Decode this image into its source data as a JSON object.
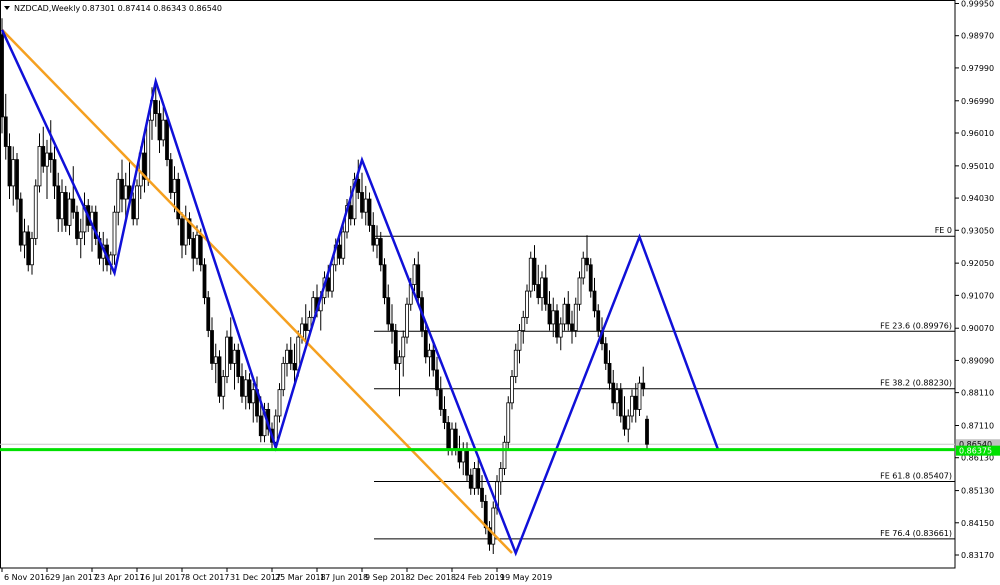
{
  "chart_data": {
    "type": "candlestick",
    "title": "NZDCAD,Weekly",
    "ohlc_header": [
      "0.87301",
      "0.87414",
      "0.86343",
      "0.86540"
    ],
    "ylim": [
      0.8317,
      0.9995
    ],
    "y_ticks": [
      "0.99950",
      "0.98970",
      "0.97990",
      "0.96990",
      "0.96010",
      "0.95010",
      "0.94030",
      "0.93050",
      "0.92050",
      "0.91070",
      "0.90070",
      "0.89090",
      "0.88110",
      "0.87110",
      "0.86130",
      "0.85130",
      "0.84150",
      "0.83170"
    ],
    "x_ticks": [
      "6 Nov 2016",
      "29 Jan 2017",
      "23 Apr 2017",
      "16 Jul 2017",
      "8 Oct 2017",
      "31 Dec 2017",
      "25 Mar 2018",
      "17 Jun 2018",
      "9 Sep 2018",
      "2 Dec 2018",
      "24 Feb 2019",
      "19 May 2019"
    ],
    "price_label_current": "0.86540",
    "price_label_level": "0.86375",
    "current_price": 0.8654,
    "support_level": 0.86375,
    "fib_levels": [
      {
        "label": "FE 0",
        "value": 0.9287
      },
      {
        "label": "FE 23.6 (0.89976)",
        "value": 0.89976
      },
      {
        "label": "FE 38.2 (0.88230)",
        "value": 0.8823
      },
      {
        "label": "FE 61.8 (0.85407)",
        "value": 0.85407
      },
      {
        "label": "FE 76.4 (0.83661)",
        "value": 0.83661
      }
    ],
    "zigzag": [
      {
        "week": 0,
        "price": 0.9915
      },
      {
        "week": 30,
        "price": 0.9175
      },
      {
        "week": 41,
        "price": 0.9758
      },
      {
        "week": 73,
        "price": 0.8644
      },
      {
        "week": 96,
        "price": 0.9519
      },
      {
        "week": 137,
        "price": 0.8323
      },
      {
        "week": 170,
        "price": 0.9285
      },
      {
        "week": 191,
        "price": 0.8636
      }
    ],
    "trendline": [
      {
        "week": 0,
        "price": 0.9915
      },
      {
        "week": 136,
        "price": 0.8323
      }
    ],
    "colors": {
      "zigzag": "#1010d8",
      "trendline": "#f5a020",
      "support": "#00e000",
      "fib": "#000000",
      "bull": "#ffffff",
      "bear": "#000000"
    },
    "candles": [
      [
        0.99,
        0.995,
        0.96,
        0.965
      ],
      [
        0.965,
        0.972,
        0.952,
        0.956
      ],
      [
        0.956,
        0.96,
        0.94,
        0.944
      ],
      [
        0.944,
        0.956,
        0.938,
        0.952
      ],
      [
        0.952,
        0.954,
        0.936,
        0.94
      ],
      [
        0.94,
        0.942,
        0.924,
        0.926
      ],
      [
        0.926,
        0.934,
        0.922,
        0.93
      ],
      [
        0.93,
        0.932,
        0.918,
        0.92
      ],
      [
        0.92,
        0.93,
        0.917,
        0.928
      ],
      [
        0.928,
        0.946,
        0.926,
        0.944
      ],
      [
        0.944,
        0.96,
        0.942,
        0.956
      ],
      [
        0.956,
        0.962,
        0.948,
        0.95
      ],
      [
        0.95,
        0.958,
        0.94,
        0.954
      ],
      [
        0.954,
        0.964,
        0.948,
        0.952
      ],
      [
        0.952,
        0.956,
        0.94,
        0.944
      ],
      [
        0.944,
        0.948,
        0.93,
        0.934
      ],
      [
        0.934,
        0.946,
        0.93,
        0.942
      ],
      [
        0.942,
        0.944,
        0.93,
        0.932
      ],
      [
        0.932,
        0.942,
        0.929,
        0.94
      ],
      [
        0.94,
        0.95,
        0.934,
        0.936
      ],
      [
        0.936,
        0.938,
        0.926,
        0.928
      ],
      [
        0.928,
        0.934,
        0.922,
        0.93
      ],
      [
        0.93,
        0.942,
        0.926,
        0.938
      ],
      [
        0.938,
        0.94,
        0.93,
        0.932
      ],
      [
        0.932,
        0.938,
        0.924,
        0.936
      ],
      [
        0.936,
        0.938,
        0.926,
        0.928
      ],
      [
        0.928,
        0.93,
        0.92,
        0.922
      ],
      [
        0.922,
        0.93,
        0.918,
        0.926
      ],
      [
        0.926,
        0.928,
        0.918,
        0.92
      ],
      [
        0.92,
        0.924,
        0.917,
        0.923
      ],
      [
        0.923,
        0.938,
        0.92,
        0.936
      ],
      [
        0.936,
        0.948,
        0.932,
        0.946
      ],
      [
        0.946,
        0.952,
        0.936,
        0.94
      ],
      [
        0.94,
        0.948,
        0.934,
        0.944
      ],
      [
        0.944,
        0.952,
        0.938,
        0.94
      ],
      [
        0.94,
        0.942,
        0.932,
        0.934
      ],
      [
        0.934,
        0.946,
        0.932,
        0.944
      ],
      [
        0.944,
        0.956,
        0.94,
        0.954
      ],
      [
        0.954,
        0.96,
        0.942,
        0.946
      ],
      [
        0.946,
        0.966,
        0.944,
        0.964
      ],
      [
        0.964,
        0.974,
        0.958,
        0.97
      ],
      [
        0.97,
        0.976,
        0.962,
        0.966
      ],
      [
        0.966,
        0.97,
        0.954,
        0.958
      ],
      [
        0.958,
        0.968,
        0.956,
        0.964
      ],
      [
        0.964,
        0.966,
        0.95,
        0.952
      ],
      [
        0.952,
        0.954,
        0.94,
        0.942
      ],
      [
        0.942,
        0.95,
        0.936,
        0.946
      ],
      [
        0.946,
        0.948,
        0.932,
        0.934
      ],
      [
        0.934,
        0.936,
        0.922,
        0.926
      ],
      [
        0.926,
        0.938,
        0.923,
        0.934
      ],
      [
        0.934,
        0.936,
        0.926,
        0.928
      ],
      [
        0.928,
        0.93,
        0.918,
        0.922
      ],
      [
        0.922,
        0.932,
        0.92,
        0.929
      ],
      [
        0.929,
        0.931,
        0.918,
        0.92
      ],
      [
        0.92,
        0.922,
        0.908,
        0.91
      ],
      [
        0.91,
        0.912,
        0.898,
        0.9
      ],
      [
        0.9,
        0.904,
        0.888,
        0.89
      ],
      [
        0.89,
        0.896,
        0.884,
        0.892
      ],
      [
        0.892,
        0.894,
        0.878,
        0.88
      ],
      [
        0.88,
        0.888,
        0.876,
        0.886
      ],
      [
        0.886,
        0.9,
        0.884,
        0.898
      ],
      [
        0.898,
        0.904,
        0.888,
        0.89
      ],
      [
        0.89,
        0.896,
        0.882,
        0.894
      ],
      [
        0.894,
        0.896,
        0.884,
        0.886
      ],
      [
        0.886,
        0.89,
        0.878,
        0.88
      ],
      [
        0.88,
        0.888,
        0.876,
        0.885
      ],
      [
        0.885,
        0.887,
        0.876,
        0.878
      ],
      [
        0.878,
        0.884,
        0.872,
        0.882
      ],
      [
        0.882,
        0.886,
        0.872,
        0.874
      ],
      [
        0.874,
        0.88,
        0.866,
        0.868
      ],
      [
        0.868,
        0.878,
        0.866,
        0.876
      ],
      [
        0.876,
        0.878,
        0.868,
        0.87
      ],
      [
        0.87,
        0.872,
        0.864,
        0.866
      ],
      [
        0.866,
        0.876,
        0.864,
        0.874
      ],
      [
        0.874,
        0.884,
        0.872,
        0.882
      ],
      [
        0.882,
        0.892,
        0.88,
        0.89
      ],
      [
        0.89,
        0.896,
        0.886,
        0.894
      ],
      [
        0.894,
        0.898,
        0.888,
        0.89
      ],
      [
        0.89,
        0.896,
        0.884,
        0.888
      ],
      [
        0.888,
        0.9,
        0.886,
        0.898
      ],
      [
        0.898,
        0.904,
        0.896,
        0.902
      ],
      [
        0.902,
        0.908,
        0.896,
        0.9
      ],
      [
        0.9,
        0.906,
        0.898,
        0.904
      ],
      [
        0.904,
        0.912,
        0.902,
        0.91
      ],
      [
        0.91,
        0.914,
        0.904,
        0.906
      ],
      [
        0.906,
        0.912,
        0.9,
        0.91
      ],
      [
        0.91,
        0.918,
        0.908,
        0.916
      ],
      [
        0.916,
        0.92,
        0.91,
        0.912
      ],
      [
        0.912,
        0.922,
        0.91,
        0.92
      ],
      [
        0.92,
        0.928,
        0.918,
        0.926
      ],
      [
        0.926,
        0.93,
        0.92,
        0.922
      ],
      [
        0.922,
        0.932,
        0.92,
        0.93
      ],
      [
        0.93,
        0.94,
        0.928,
        0.938
      ],
      [
        0.938,
        0.944,
        0.932,
        0.934
      ],
      [
        0.934,
        0.948,
        0.932,
        0.946
      ],
      [
        0.946,
        0.952,
        0.94,
        0.942
      ],
      [
        0.942,
        0.948,
        0.934,
        0.936
      ],
      [
        0.936,
        0.944,
        0.932,
        0.94
      ],
      [
        0.94,
        0.942,
        0.93,
        0.932
      ],
      [
        0.932,
        0.936,
        0.924,
        0.926
      ],
      [
        0.926,
        0.932,
        0.922,
        0.928
      ],
      [
        0.928,
        0.93,
        0.918,
        0.92
      ],
      [
        0.92,
        0.922,
        0.908,
        0.91
      ],
      [
        0.91,
        0.914,
        0.9,
        0.902
      ],
      [
        0.902,
        0.908,
        0.896,
        0.9
      ],
      [
        0.9,
        0.902,
        0.888,
        0.89
      ],
      [
        0.89,
        0.894,
        0.88,
        0.892
      ],
      [
        0.892,
        0.9,
        0.886,
        0.898
      ],
      [
        0.898,
        0.91,
        0.896,
        0.908
      ],
      [
        0.908,
        0.916,
        0.906,
        0.914
      ],
      [
        0.914,
        0.922,
        0.912,
        0.92
      ],
      [
        0.92,
        0.924,
        0.908,
        0.91
      ],
      [
        0.91,
        0.912,
        0.898,
        0.9
      ],
      [
        0.9,
        0.902,
        0.89,
        0.892
      ],
      [
        0.892,
        0.896,
        0.886,
        0.894
      ],
      [
        0.894,
        0.896,
        0.886,
        0.888
      ],
      [
        0.888,
        0.892,
        0.88,
        0.882
      ],
      [
        0.882,
        0.886,
        0.874,
        0.876
      ],
      [
        0.876,
        0.88,
        0.87,
        0.872
      ],
      [
        0.872,
        0.874,
        0.862,
        0.864
      ],
      [
        0.864,
        0.872,
        0.862,
        0.87
      ],
      [
        0.87,
        0.872,
        0.862,
        0.864
      ],
      [
        0.864,
        0.868,
        0.858,
        0.86
      ],
      [
        0.86,
        0.866,
        0.856,
        0.864
      ],
      [
        0.864,
        0.866,
        0.854,
        0.856
      ],
      [
        0.856,
        0.858,
        0.85,
        0.852
      ],
      [
        0.852,
        0.86,
        0.85,
        0.858
      ],
      [
        0.858,
        0.862,
        0.85,
        0.852
      ],
      [
        0.852,
        0.856,
        0.846,
        0.848
      ],
      [
        0.848,
        0.85,
        0.838,
        0.84
      ],
      [
        0.84,
        0.842,
        0.833,
        0.835
      ],
      [
        0.835,
        0.848,
        0.832,
        0.846
      ],
      [
        0.846,
        0.856,
        0.844,
        0.854
      ],
      [
        0.854,
        0.86,
        0.85,
        0.858
      ],
      [
        0.858,
        0.868,
        0.856,
        0.866
      ],
      [
        0.866,
        0.88,
        0.864,
        0.878
      ],
      [
        0.878,
        0.888,
        0.876,
        0.886
      ],
      [
        0.886,
        0.896,
        0.884,
        0.894
      ],
      [
        0.894,
        0.902,
        0.89,
        0.9
      ],
      [
        0.9,
        0.906,
        0.896,
        0.904
      ],
      [
        0.904,
        0.914,
        0.902,
        0.912
      ],
      [
        0.912,
        0.924,
        0.91,
        0.922
      ],
      [
        0.922,
        0.926,
        0.912,
        0.914
      ],
      [
        0.914,
        0.92,
        0.908,
        0.91
      ],
      [
        0.91,
        0.918,
        0.906,
        0.916
      ],
      [
        0.916,
        0.92,
        0.906,
        0.908
      ],
      [
        0.908,
        0.912,
        0.9,
        0.902
      ],
      [
        0.902,
        0.91,
        0.898,
        0.906
      ],
      [
        0.906,
        0.908,
        0.896,
        0.898
      ],
      [
        0.898,
        0.904,
        0.894,
        0.902
      ],
      [
        0.902,
        0.91,
        0.9,
        0.908
      ],
      [
        0.908,
        0.912,
        0.9,
        0.902
      ],
      [
        0.902,
        0.906,
        0.896,
        0.9
      ],
      [
        0.9,
        0.91,
        0.898,
        0.908
      ],
      [
        0.908,
        0.918,
        0.906,
        0.916
      ],
      [
        0.916,
        0.924,
        0.914,
        0.922
      ],
      [
        0.922,
        0.929,
        0.918,
        0.92
      ],
      [
        0.92,
        0.922,
        0.91,
        0.912
      ],
      [
        0.912,
        0.916,
        0.904,
        0.906
      ],
      [
        0.906,
        0.908,
        0.898,
        0.9
      ],
      [
        0.9,
        0.904,
        0.894,
        0.896
      ],
      [
        0.896,
        0.898,
        0.888,
        0.89
      ],
      [
        0.89,
        0.894,
        0.882,
        0.884
      ],
      [
        0.884,
        0.888,
        0.876,
        0.878
      ],
      [
        0.878,
        0.884,
        0.874,
        0.882
      ],
      [
        0.882,
        0.884,
        0.872,
        0.874
      ],
      [
        0.874,
        0.88,
        0.868,
        0.87
      ],
      [
        0.87,
        0.876,
        0.866,
        0.874
      ],
      [
        0.874,
        0.882,
        0.872,
        0.88
      ],
      [
        0.88,
        0.884,
        0.872,
        0.876
      ],
      [
        0.876,
        0.886,
        0.874,
        0.884
      ],
      [
        0.884,
        0.889,
        0.88,
        0.8823
      ],
      [
        0.873,
        0.8741,
        0.8634,
        0.8654
      ]
    ]
  }
}
